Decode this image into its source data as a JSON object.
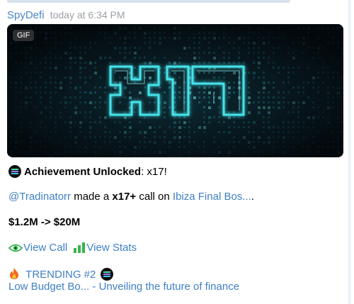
{
  "message": {
    "sender": "SpyDefi",
    "time": "today at 6:34 PM",
    "media_badge": "GIF",
    "gif_text": "x17",
    "achievement_label": "Achievement Unlocked",
    "achievement_value": ": x17!",
    "mention": "@Tradinatorr",
    "made_text": " made a ",
    "call_multiplier": "x17+",
    "call_on_text": " call on ",
    "token_link": "Ibiza Final Bos...",
    "token_suffix": ".",
    "market_cap": "$1.2M -> $20M",
    "view_call": "View Call",
    "view_stats": "View Stats",
    "trending": "TRENDING #2",
    "trending_link": "Low Budget Bo... - Unveiling the future of finance"
  },
  "colors": {
    "link": "#3f80c4",
    "sender": "#4a86c5",
    "gif_glow": "#37d3dc"
  },
  "icons": [
    "sol-icon",
    "eye-icon",
    "chart-icon",
    "fire-icon"
  ]
}
